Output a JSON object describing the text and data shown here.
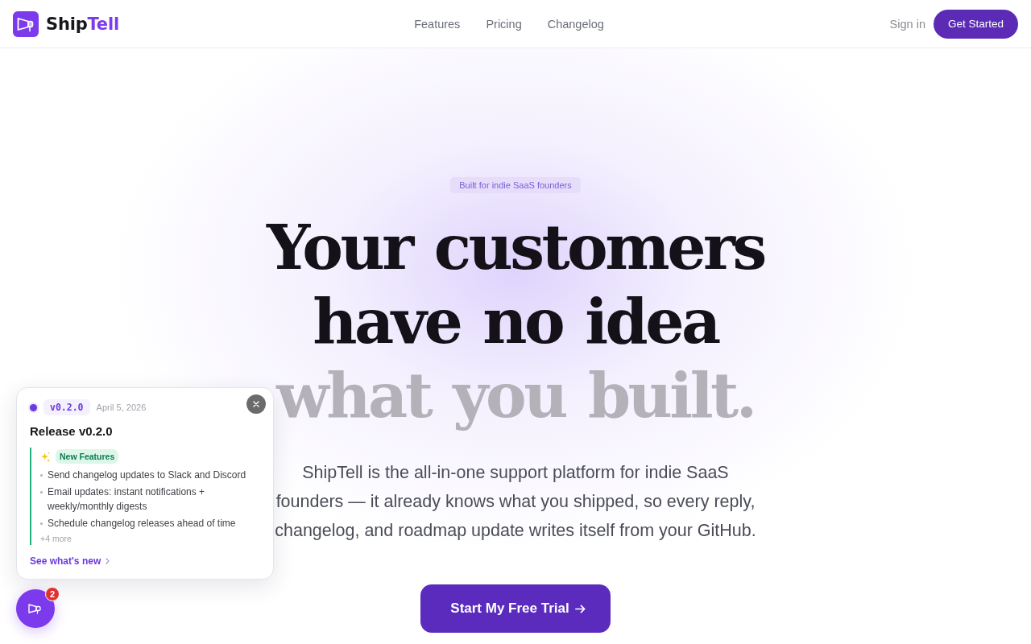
{
  "header": {
    "logo": {
      "name_parts": [
        {
          "text": "Ship",
          "accent": false
        },
        {
          "text": "Tell",
          "accent": true
        }
      ]
    },
    "nav": [
      {
        "label": "Features"
      },
      {
        "label": "Pricing"
      },
      {
        "label": "Changelog"
      }
    ],
    "sign_in": "Sign in",
    "cta": "Get Started"
  },
  "hero": {
    "badge": "Built for indie SaaS founders",
    "headline": [
      {
        "text": "Your customers",
        "muted": false
      },
      {
        "text": "have no idea",
        "muted": false
      },
      {
        "text": "what you built.",
        "muted": true
      }
    ],
    "description": "ShipTell is the all-in-one support platform for indie SaaS founders — it already knows what you shipped, so every reply, changelog, and roadmap update writes itself from your GitHub.",
    "cta": "Start My Free Trial"
  },
  "changelog_popup": {
    "version": "v0.2.0",
    "date": "April 5, 2026",
    "title": "Release v0.2.0",
    "section": {
      "tag": "New Features",
      "items": [
        "Send changelog updates to Slack and Discord",
        "Email updates: instant notifications + weekly/monthly digests",
        "Schedule changelog releases ahead of time"
      ],
      "more": "+4 more"
    },
    "link": "See what's new"
  },
  "launcher": {
    "badge": "2"
  }
}
